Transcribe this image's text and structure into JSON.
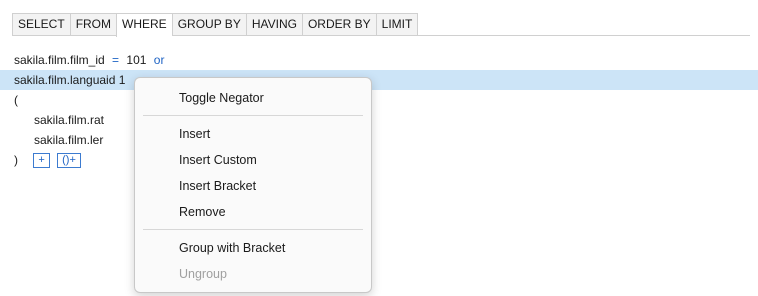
{
  "tabs": [
    "SELECT",
    "FROM",
    "WHERE",
    "GROUP BY",
    "HAVING",
    "ORDER BY",
    "LIMIT"
  ],
  "active_tab": "WHERE",
  "editor": {
    "line1": {
      "text": "sakila.film.film_id",
      "op": "=",
      "value": "101",
      "conj": "or"
    },
    "line2": {
      "text": "sakila.film.langua",
      "tail": "id  1"
    },
    "open_paren": "(",
    "line3": {
      "text": "sakila.film.rat"
    },
    "line4": {
      "text": "sakila.film.ler"
    },
    "close_paren": ")",
    "add_label": "+",
    "add_bracket_label": "()+"
  },
  "context_menu": {
    "toggle_negator": "Toggle Negator",
    "insert": "Insert",
    "insert_custom": "Insert Custom",
    "insert_bracket": "Insert Bracket",
    "remove": "Remove",
    "group_with_bracket": "Group with Bracket",
    "ungroup": "Ungroup"
  },
  "colors": {
    "accent": "#1e63c4",
    "selection": "#cce4f7"
  }
}
